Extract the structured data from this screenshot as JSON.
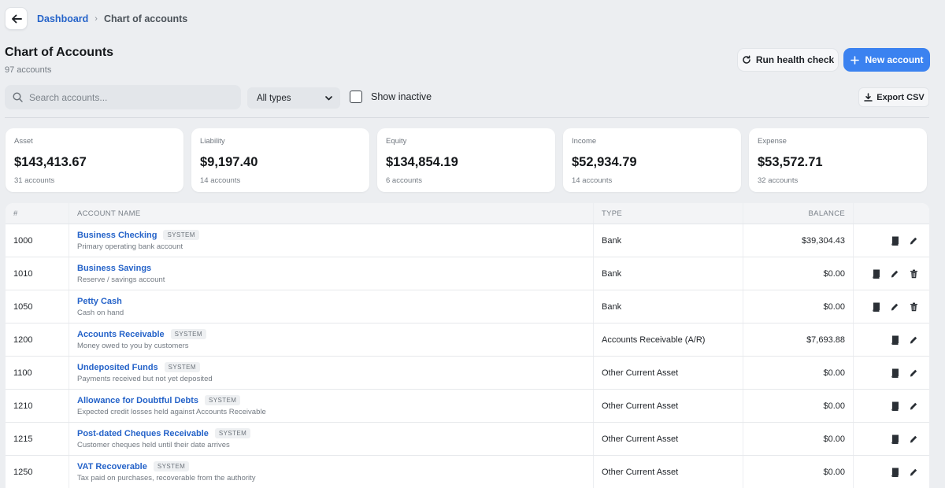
{
  "breadcrumb": {
    "home": "Dashboard",
    "separator": "›",
    "current": "Chart of accounts"
  },
  "header": {
    "title": "Chart of Accounts",
    "subtitle": "97 accounts",
    "health_label": "Run health check",
    "new_label": "New account"
  },
  "filters": {
    "search_placeholder": "Search accounts...",
    "type_selected": "All types",
    "inactive_label": "Show inactive",
    "export_label": "Export CSV"
  },
  "summary": [
    {
      "label": "Asset",
      "value": "$143,413.67",
      "count": "31 accounts"
    },
    {
      "label": "Liability",
      "value": "$9,197.40",
      "count": "14 accounts"
    },
    {
      "label": "Equity",
      "value": "$134,854.19",
      "count": "6 accounts"
    },
    {
      "label": "Income",
      "value": "$52,934.79",
      "count": "14 accounts"
    },
    {
      "label": "Expense",
      "value": "$53,572.71",
      "count": "32 accounts"
    }
  ],
  "table": {
    "columns": {
      "num": "#",
      "name": "ACCOUNT NAME",
      "type": "TYPE",
      "balance": "BALANCE"
    },
    "rows": [
      {
        "num": "1000",
        "name": "Business Checking",
        "badge": "SYSTEM",
        "desc": "Primary operating bank account",
        "type": "Bank",
        "balance": "$39,304.43",
        "deletable": false
      },
      {
        "num": "1010",
        "name": "Business Savings",
        "badge": "",
        "desc": "Reserve / savings account",
        "type": "Bank",
        "balance": "$0.00",
        "deletable": true
      },
      {
        "num": "1050",
        "name": "Petty Cash",
        "badge": "",
        "desc": "Cash on hand",
        "type": "Bank",
        "balance": "$0.00",
        "deletable": true
      },
      {
        "num": "1200",
        "name": "Accounts Receivable",
        "badge": "SYSTEM",
        "desc": "Money owed to you by customers",
        "type": "Accounts Receivable (A/R)",
        "balance": "$7,693.88",
        "deletable": false
      },
      {
        "num": "1100",
        "name": "Undeposited Funds",
        "badge": "SYSTEM",
        "desc": "Payments received but not yet deposited",
        "type": "Other Current Asset",
        "balance": "$0.00",
        "deletable": false
      },
      {
        "num": "1210",
        "name": "Allowance for Doubtful Debts",
        "badge": "SYSTEM",
        "desc": "Expected credit losses held against Accounts Receivable",
        "type": "Other Current Asset",
        "balance": "$0.00",
        "deletable": false
      },
      {
        "num": "1215",
        "name": "Post-dated Cheques Receivable",
        "badge": "SYSTEM",
        "desc": "Customer cheques held until their date arrives",
        "type": "Other Current Asset",
        "balance": "$0.00",
        "deletable": false
      },
      {
        "num": "1250",
        "name": "VAT Recoverable",
        "badge": "SYSTEM",
        "desc": "Tax paid on purchases, recoverable from the authority",
        "type": "Other Current Asset",
        "balance": "$0.00",
        "deletable": false
      }
    ]
  },
  "colors": {
    "accent": "#3b82f0",
    "link": "#2563c9",
    "background": "#eceef1"
  },
  "icons": {
    "back": "arrow-left-icon",
    "health": "refresh-icon",
    "new": "plus-icon",
    "search": "search-icon",
    "select": "chevron-down-icon",
    "export": "download-icon",
    "ledger": "book-icon",
    "edit": "pencil-icon",
    "delete": "trash-icon"
  }
}
